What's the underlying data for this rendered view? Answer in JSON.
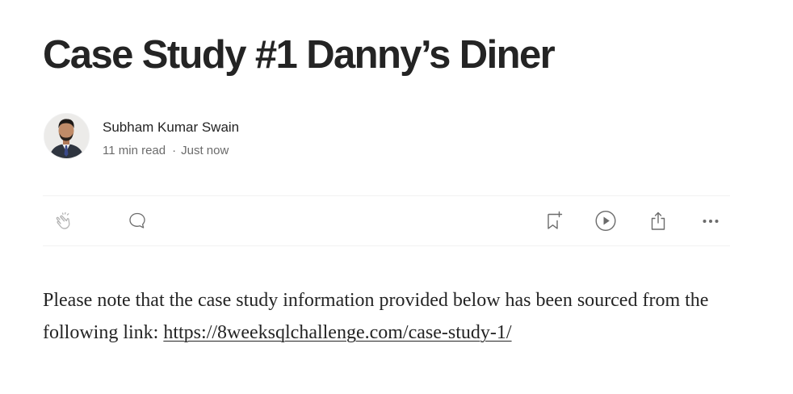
{
  "article": {
    "title": "Case Study #1 Danny’s Diner",
    "author": {
      "name": "Subham Kumar Swain"
    },
    "meta": {
      "read_time": "11 min read",
      "separator": "·",
      "published": "Just now"
    },
    "actions": {
      "clap_icon": "clap-icon",
      "comment_icon": "comment-icon",
      "save_icon": "bookmark-add-icon",
      "listen_icon": "play-icon",
      "share_icon": "share-icon",
      "more_icon": "more-options-icon"
    },
    "body": {
      "intro_text": "Please note that the case study information provided below has been sourced from the following link: ",
      "link_text": "https://8weeksqlchallenge.com/case-study-1/"
    }
  },
  "colors": {
    "text_primary": "#242424",
    "text_secondary": "#6b6b6b",
    "icon": "#6b6b6b",
    "icon_muted": "#b3b3b3",
    "divider": "#f2f2f2"
  }
}
